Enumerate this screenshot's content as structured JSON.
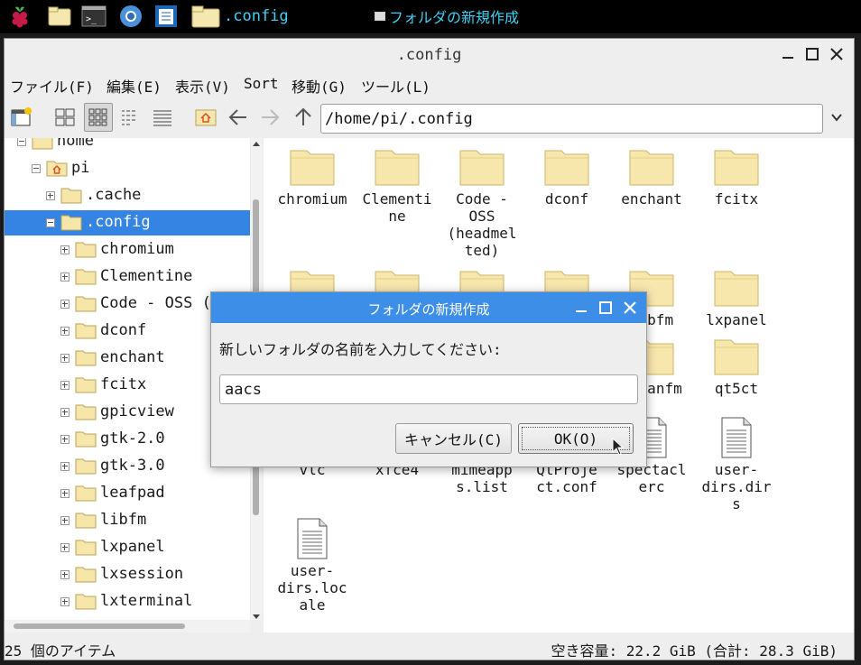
{
  "taskbar": {
    "folder_label": ".config",
    "task_label": "フォルダの新規作成"
  },
  "window": {
    "title": ".config"
  },
  "menu": [
    "ファイル(F)",
    "編集(E)",
    "表示(V)",
    "Sort",
    "移動(G)",
    "ツール(L)"
  ],
  "path": "/home/pi/.config",
  "tree": [
    {
      "label": "home",
      "level": 0,
      "icon": "folder",
      "expanded": true
    },
    {
      "label": "pi",
      "level": 1,
      "icon": "home-folder",
      "expanded": true
    },
    {
      "label": ".cache",
      "level": 2,
      "icon": "folder",
      "expanded": false
    },
    {
      "label": ".config",
      "level": 2,
      "icon": "folder",
      "expanded": true,
      "selected": true
    },
    {
      "label": "chromium",
      "level": 3,
      "icon": "folder",
      "expanded": false
    },
    {
      "label": "Clementine",
      "level": 3,
      "icon": "folder",
      "expanded": false
    },
    {
      "label": "Code - OSS (h",
      "level": 3,
      "icon": "folder",
      "expanded": false
    },
    {
      "label": "dconf",
      "level": 3,
      "icon": "folder",
      "expanded": false
    },
    {
      "label": "enchant",
      "level": 3,
      "icon": "folder",
      "expanded": false
    },
    {
      "label": "fcitx",
      "level": 3,
      "icon": "folder",
      "expanded": false
    },
    {
      "label": "gpicview",
      "level": 3,
      "icon": "folder",
      "expanded": false
    },
    {
      "label": "gtk-2.0",
      "level": 3,
      "icon": "folder",
      "expanded": false
    },
    {
      "label": "gtk-3.0",
      "level": 3,
      "icon": "folder",
      "expanded": false
    },
    {
      "label": "leafpad",
      "level": 3,
      "icon": "folder",
      "expanded": false
    },
    {
      "label": "libfm",
      "level": 3,
      "icon": "folder",
      "expanded": false
    },
    {
      "label": "lxpanel",
      "level": 3,
      "icon": "folder",
      "expanded": false
    },
    {
      "label": "lxsession",
      "level": 3,
      "icon": "folder",
      "expanded": false
    },
    {
      "label": "lxterminal",
      "level": 3,
      "icon": "folder",
      "expanded": false
    }
  ],
  "files": [
    {
      "label": "chromium",
      "type": "folder"
    },
    {
      "label": "Clementi\nne",
      "type": "folder"
    },
    {
      "label": "Code -\nOSS\n(headmel\nted)",
      "type": "folder"
    },
    {
      "label": "dconf",
      "type": "folder"
    },
    {
      "label": "enchant",
      "type": "folder"
    },
    {
      "label": "fcitx",
      "type": "folder"
    },
    {
      "label": "",
      "type": "folder"
    },
    {
      "label": "",
      "type": "folder"
    },
    {
      "label": "",
      "type": "folder"
    },
    {
      "label": "",
      "type": "folder"
    },
    {
      "label": "libfm",
      "type": "folder"
    },
    {
      "label": "lxpanel",
      "type": "folder"
    },
    {
      "label": "",
      "type": "folder"
    },
    {
      "label": "",
      "type": "folder"
    },
    {
      "label": "",
      "type": "folder"
    },
    {
      "label": "",
      "type": "folder"
    },
    {
      "label": "pcmanfm",
      "type": "folder"
    },
    {
      "label": "qt5ct",
      "type": "folder"
    },
    {
      "label": "vlc",
      "type": "folder"
    },
    {
      "label": "xfce4",
      "type": "folder"
    },
    {
      "label": "mimeapp\ns.list",
      "type": "file"
    },
    {
      "label": "QtProje\nct.conf",
      "type": "file"
    },
    {
      "label": "spectacl\nerc",
      "type": "file"
    },
    {
      "label": "user-\ndirs.dir\ns",
      "type": "file"
    },
    {
      "label": "user-\ndirs.loc\nale",
      "type": "file"
    }
  ],
  "status": {
    "count": "25 個のアイテム",
    "free": "空き容量: 22.2 GiB (合計: 28.3 GiB)"
  },
  "dialog": {
    "title": "フォルダの新規作成",
    "prompt": "新しいフォルダの名前を入力してください:",
    "value": "aacs",
    "cancel_label": "キャンセル(C)",
    "ok_label": "OK(O)"
  }
}
